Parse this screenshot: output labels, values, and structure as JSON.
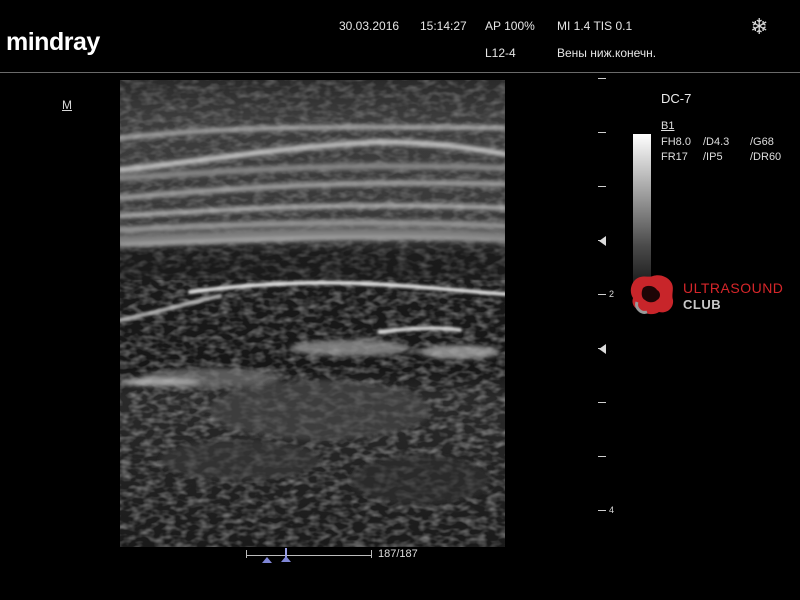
{
  "brand": {
    "logo": "mindray"
  },
  "header": {
    "date": "30.03.2016",
    "time": "15:14:27",
    "ap": "AP  100%",
    "mi_tis": "MI 1.4 TIS 0.1",
    "probe": "L12-4",
    "exam": "Вены ниж.конечн.",
    "freeze_icon": "snowflake-icon"
  },
  "left": {
    "orientation_marker": "M"
  },
  "depth_scale": {
    "labels": [
      "2",
      "4"
    ]
  },
  "right_panel": {
    "probe_type": "DC-7",
    "mode": "B1",
    "params_row1": [
      "FH8.0",
      "/D4.3",
      "/G68"
    ],
    "params_row2": [
      "FR17",
      "/IP5",
      "/DR60"
    ]
  },
  "watermark": {
    "line1": "ULTRASOUND",
    "line2": "CLUB",
    "color": "#d6262a"
  },
  "cine": {
    "frame": "187/187"
  }
}
